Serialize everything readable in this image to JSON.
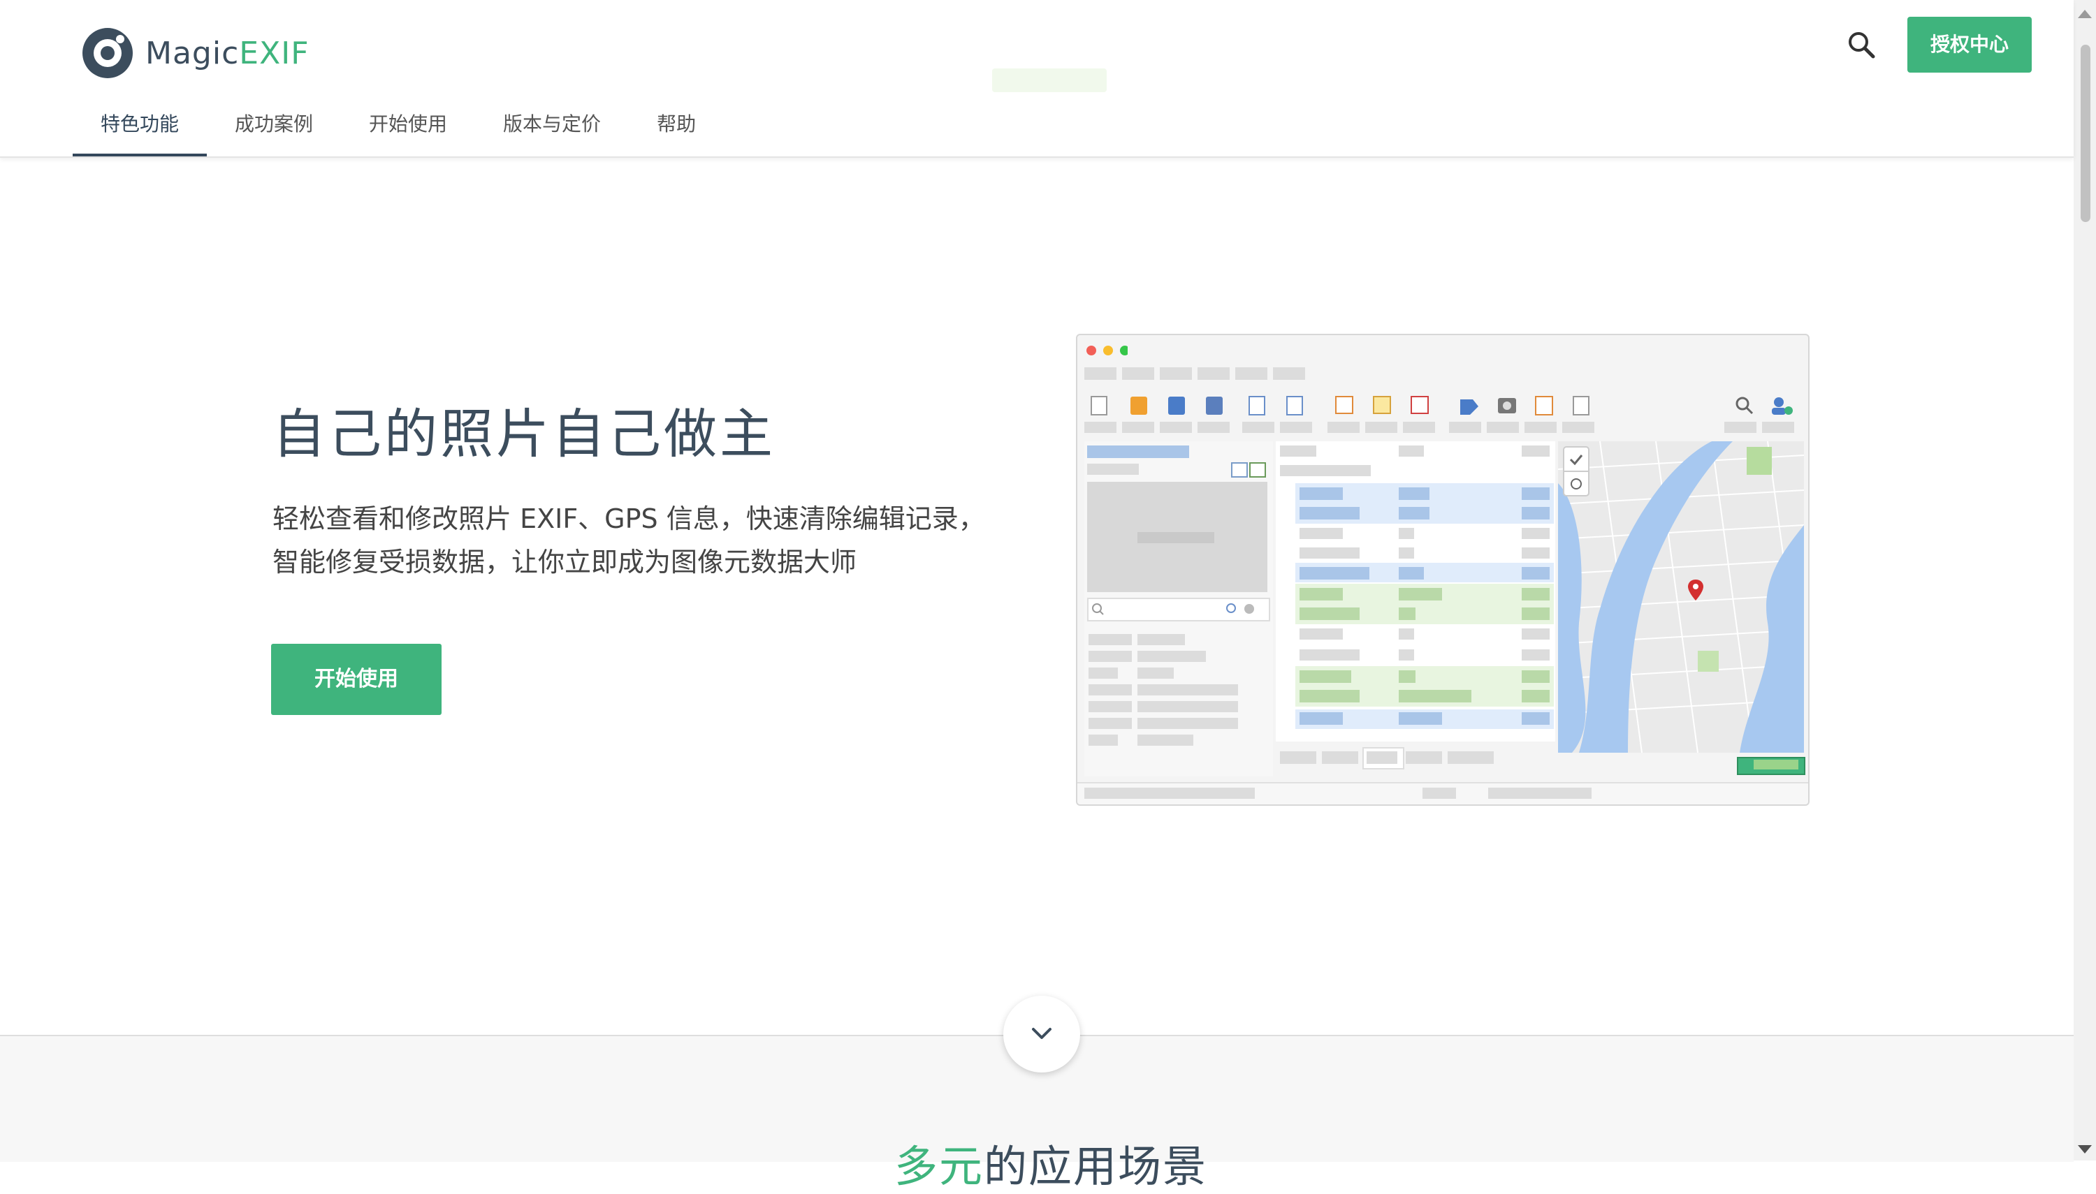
{
  "brand": {
    "name_part1": "Magic",
    "name_part2": "EXIF"
  },
  "nav": {
    "items": [
      {
        "label": "特色功能",
        "active": true
      },
      {
        "label": "成功案例",
        "active": false
      },
      {
        "label": "开始使用",
        "active": false
      },
      {
        "label": "版本与定价",
        "active": false
      },
      {
        "label": "帮助",
        "active": false
      }
    ]
  },
  "header": {
    "search_icon": "search-icon",
    "license_label": "授权中心"
  },
  "hero": {
    "title": "自己的照片自己做主",
    "subtitle_line1": "轻松查看和修改照片 EXIF、GPS 信息，快速清除编辑记录，",
    "subtitle_line2": "智能修复受损数据，让你立即成为图像元数据大师",
    "cta_label": "开始使用"
  },
  "section": {
    "title_accent": "多元",
    "title_rest": "的应用场景"
  },
  "colors": {
    "brand_dark": "#3c4d5d",
    "accent_green": "#3fb47d",
    "map_water": "#a7c8f0",
    "map_pin": "#d32f2f"
  }
}
